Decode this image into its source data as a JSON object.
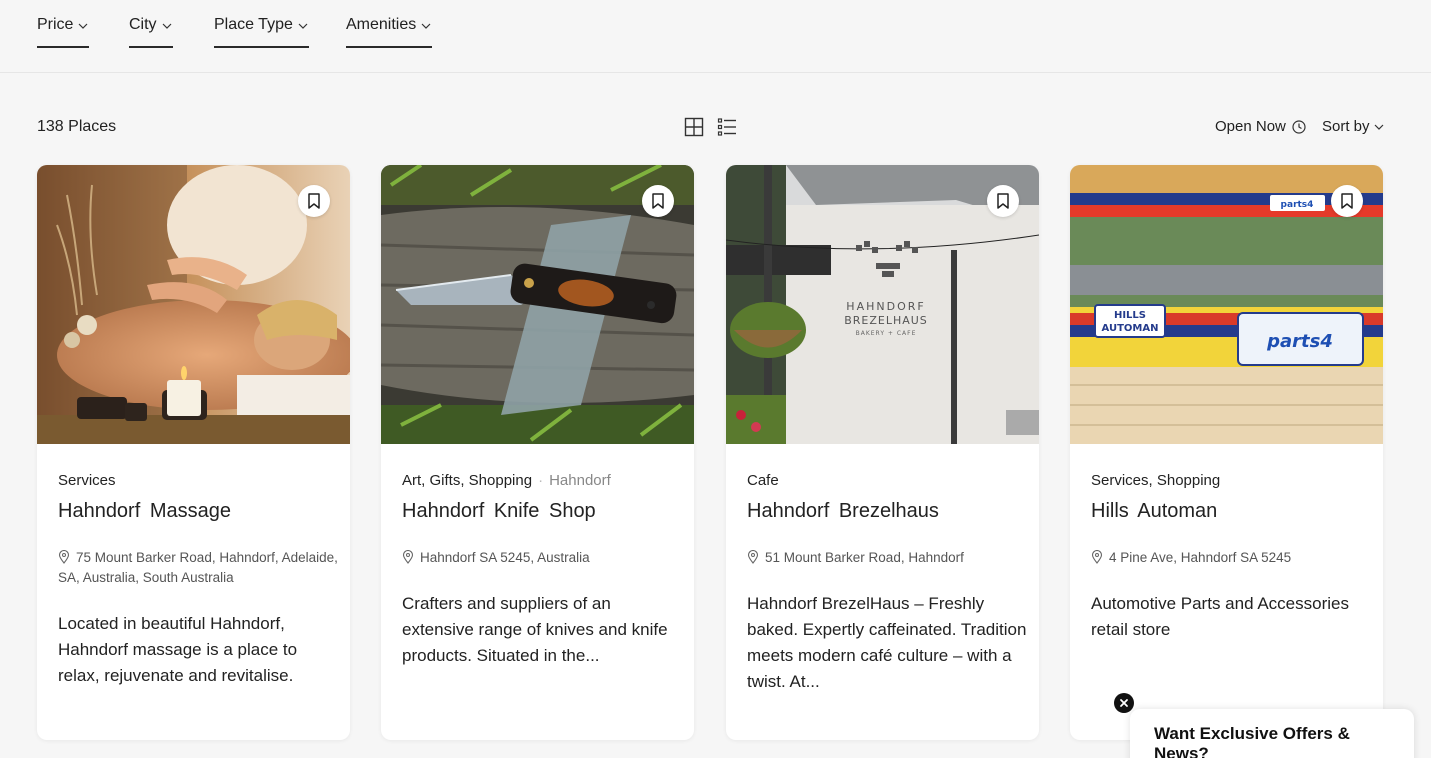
{
  "filters": [
    {
      "label": "Price"
    },
    {
      "label": "City"
    },
    {
      "label": "Place Type"
    },
    {
      "label": "Amenities"
    }
  ],
  "toolbar": {
    "count": "138 Places",
    "open_now": "Open Now",
    "sort_by": "Sort by",
    "grid_icon": "grid-view-icon",
    "list_icon": "list-view-icon"
  },
  "places": [
    {
      "categories": "Services",
      "title": "Hahndorf  Massage",
      "address": "75 Mount Barker Road, Hahndorf, Adelaide, SA, Australia, South Australia",
      "description": "Located in beautiful Hahndorf, Hahndorf massage is a place to relax, rejuvenate and revitalise."
    },
    {
      "categories": "Art,  Gifts,  Shopping",
      "location": "Hahndorf",
      "title": "Hahndorf  Knife  Shop",
      "address": "Hahndorf SA 5245, Australia",
      "description": "Crafters and suppliers of an extensive range of knives and knife products. Situated in the..."
    },
    {
      "categories": "Cafe",
      "title": "Hahndorf  Brezelhaus",
      "address": "51 Mount Barker Road, Hahndorf",
      "description": "Hahndorf BrezelHaus – Freshly baked. Expertly caffeinated. Tradition meets modern café culture – with a twist. At...",
      "image_text": {
        "line1": "HAHNDORF",
        "line2": "BREZELHAUS",
        "line3": "BAKERY + CAFE"
      }
    },
    {
      "categories": "Services,  Shopping",
      "title": "Hills  Automan",
      "address": "4 Pine Ave, Hahndorf SA 5245",
      "description": "Automotive Parts and Accessories retail store",
      "image_text": {
        "sign_left": "HILLS AUTOMAN",
        "sign_left_1": "HILLS",
        "sign_left_2": "AUTOMAN",
        "sign_right": "parts4",
        "small_sign": "parts4"
      }
    }
  ],
  "newsletter": {
    "text": "Want Exclusive Offers & News?"
  },
  "colors": {
    "background": "#f6f6f6",
    "card": "#ffffff",
    "text": "#222222"
  }
}
